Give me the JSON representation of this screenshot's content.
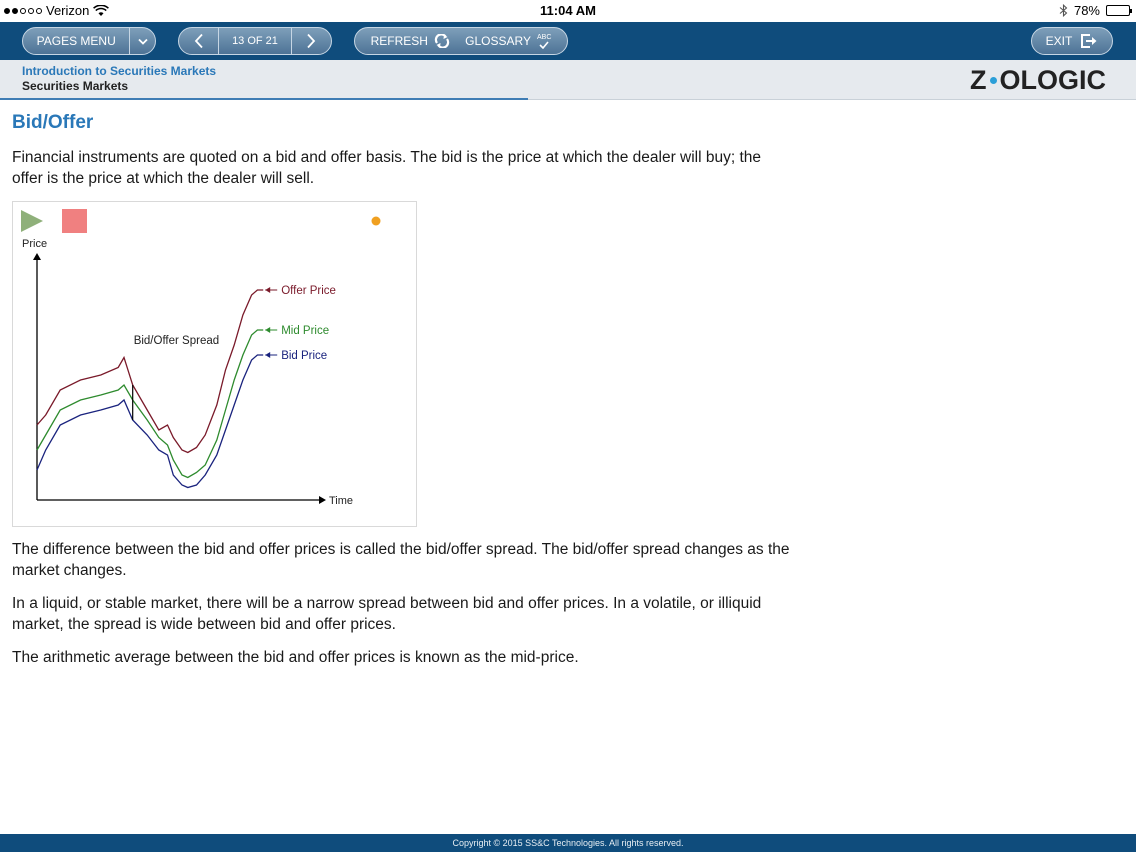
{
  "status_bar": {
    "carrier": "Verizon",
    "time": "11:04 AM",
    "battery": "78%",
    "battery_level": 0.78,
    "signal_bars_filled": 2,
    "signal_bars_total": 5
  },
  "toolbar": {
    "pages_menu": "PAGES MENU",
    "page_counter": "13 OF 21",
    "refresh": "REFRESH",
    "glossary": "GLOSSARY",
    "glossary_badge": "ABC",
    "exit": "EXIT"
  },
  "course": {
    "title": "Introduction to Securities Markets",
    "subtitle": "Securities Markets",
    "logo_left": "Z",
    "logo_right": "OLOGIC"
  },
  "content": {
    "heading": "Bid/Offer",
    "paragraphs": [
      "Financial instruments are quoted on a bid and offer basis. The bid is the price at which the dealer will buy; the offer is the price at which the dealer will sell.",
      "The difference between the bid and offer prices is called the bid/offer spread. The bid/offer spread changes as the market changes.",
      "In a liquid, or stable market, there will be a narrow spread between bid and offer prices. In a volatile, or illiquid market, the spread is wide between bid and offer prices.",
      "The arithmetic average between the bid and offer prices is known as the mid-price."
    ]
  },
  "chart_data": {
    "type": "line",
    "title": "",
    "xlabel": "Time",
    "ylabel": "Price",
    "annotation": "Bid/Offer Spread",
    "colors": {
      "offer": "#7a1a2a",
      "mid": "#2e8b2e",
      "bid": "#1a237e",
      "play": "#8fb07a",
      "stop": "#f08080",
      "indicator": "#f0a020"
    },
    "x": [
      0,
      3,
      8,
      15,
      22,
      28,
      30,
      33,
      38,
      42,
      45,
      47,
      50,
      52,
      55,
      58,
      62,
      65,
      68,
      71,
      74,
      76,
      78
    ],
    "series": [
      {
        "name": "Offer Price",
        "values": [
          30,
          34,
          44,
          48,
          50,
          53,
          57,
          46,
          36,
          28,
          30,
          25,
          20,
          19,
          21,
          26,
          38,
          52,
          62,
          74,
          82,
          84,
          84
        ]
      },
      {
        "name": "Mid Price",
        "values": [
          20,
          26,
          36,
          40,
          42,
          44,
          46,
          40,
          32,
          25,
          22,
          16,
          10,
          9,
          11,
          14,
          24,
          36,
          48,
          58,
          66,
          68,
          68
        ]
      },
      {
        "name": "Bid Price",
        "values": [
          12,
          20,
          30,
          34,
          36,
          38,
          40,
          32,
          26,
          20,
          18,
          10,
          6,
          5,
          6,
          10,
          18,
          28,
          38,
          48,
          56,
          58,
          58
        ]
      }
    ],
    "xlim": [
      0,
      100
    ],
    "ylim": [
      0,
      100
    ],
    "grid": false,
    "legend": "inline-right"
  },
  "footer": {
    "copyright": "Copyright © 2015 SS&C Technologies. All rights reserved."
  }
}
